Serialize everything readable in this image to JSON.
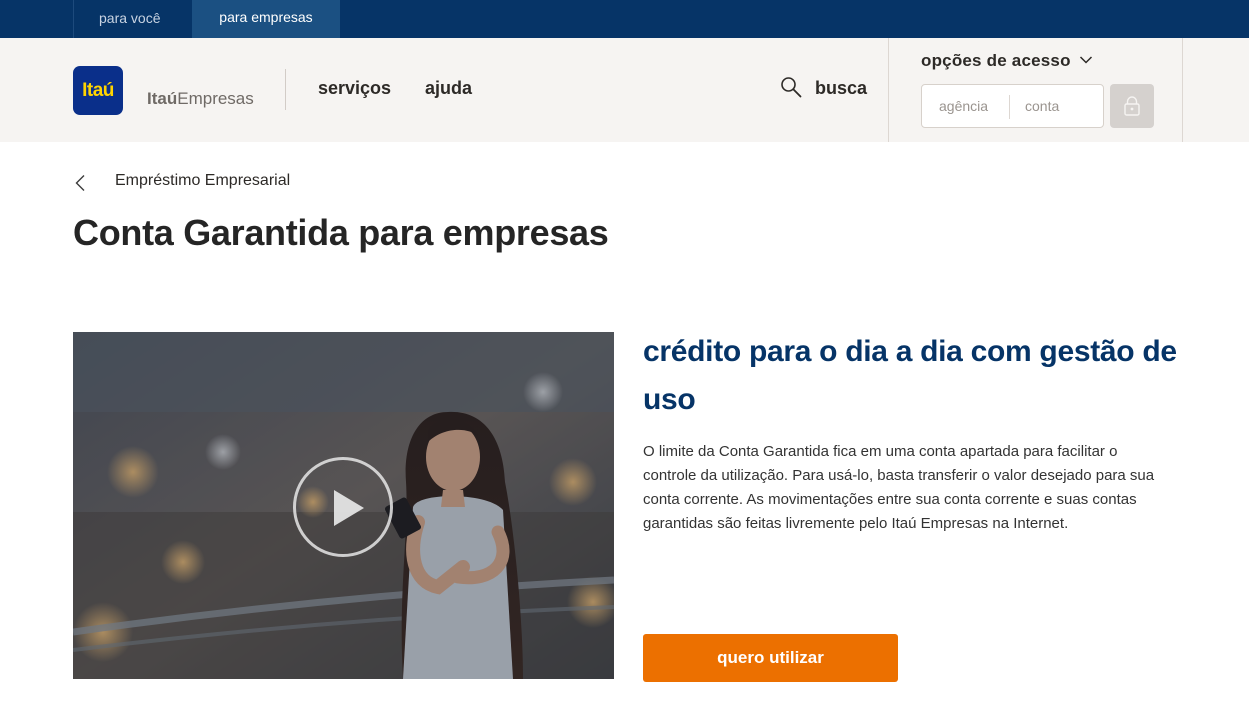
{
  "topbar": {
    "segments": [
      "para você",
      "para empresas"
    ],
    "active": "para empresas"
  },
  "header": {
    "logo_text": "Itaú",
    "brand_bold": "Itaú",
    "brand_light": "Empresas",
    "nav": [
      "serviços",
      "ajuda"
    ],
    "search_label": "busca",
    "access": {
      "title": "opções de acesso",
      "agencia_placeholder": "agência",
      "conta_placeholder": "conta"
    }
  },
  "breadcrumb": "Empréstimo Empresarial",
  "page_title": "Conta Garantida para empresas",
  "content": {
    "subtitle": "crédito para o dia a dia com gestão de uso",
    "body": "O limite da Conta Garantida fica em uma conta apartada para facilitar o controle da utilização. Para usá-lo, basta transferir o valor desejado para sua conta corrente. As movimentações entre sua conta corrente e suas contas garantidas são feitas livremente pelo Itaú Empresas na Internet.",
    "cta_label": "quero utilizar"
  },
  "colors": {
    "navy": "#063467",
    "orange": "#ec7000",
    "logo_blue": "#0a2f8a",
    "logo_yellow": "#ffd400"
  }
}
